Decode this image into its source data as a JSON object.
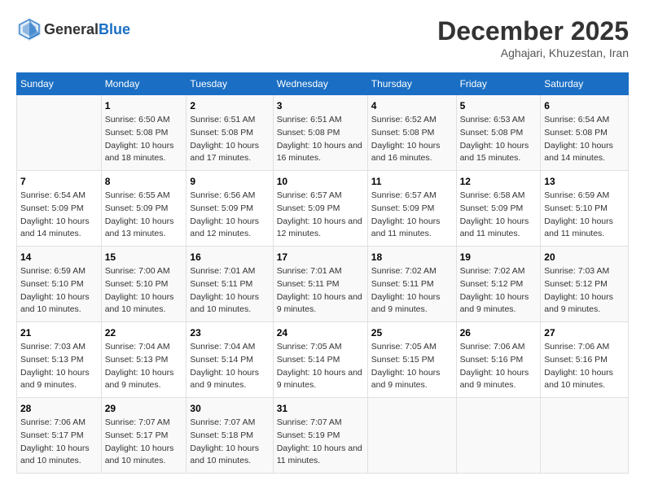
{
  "header": {
    "logo_general": "General",
    "logo_blue": "Blue",
    "month_year": "December 2025",
    "location": "Aghajari, Khuzestan, Iran"
  },
  "days_of_week": [
    "Sunday",
    "Monday",
    "Tuesday",
    "Wednesday",
    "Thursday",
    "Friday",
    "Saturday"
  ],
  "weeks": [
    [
      {
        "num": "",
        "sunrise": "",
        "sunset": "",
        "daylight": ""
      },
      {
        "num": "1",
        "sunrise": "Sunrise: 6:50 AM",
        "sunset": "Sunset: 5:08 PM",
        "daylight": "Daylight: 10 hours and 18 minutes."
      },
      {
        "num": "2",
        "sunrise": "Sunrise: 6:51 AM",
        "sunset": "Sunset: 5:08 PM",
        "daylight": "Daylight: 10 hours and 17 minutes."
      },
      {
        "num": "3",
        "sunrise": "Sunrise: 6:51 AM",
        "sunset": "Sunset: 5:08 PM",
        "daylight": "Daylight: 10 hours and 16 minutes."
      },
      {
        "num": "4",
        "sunrise": "Sunrise: 6:52 AM",
        "sunset": "Sunset: 5:08 PM",
        "daylight": "Daylight: 10 hours and 16 minutes."
      },
      {
        "num": "5",
        "sunrise": "Sunrise: 6:53 AM",
        "sunset": "Sunset: 5:08 PM",
        "daylight": "Daylight: 10 hours and 15 minutes."
      },
      {
        "num": "6",
        "sunrise": "Sunrise: 6:54 AM",
        "sunset": "Sunset: 5:08 PM",
        "daylight": "Daylight: 10 hours and 14 minutes."
      }
    ],
    [
      {
        "num": "7",
        "sunrise": "Sunrise: 6:54 AM",
        "sunset": "Sunset: 5:09 PM",
        "daylight": "Daylight: 10 hours and 14 minutes."
      },
      {
        "num": "8",
        "sunrise": "Sunrise: 6:55 AM",
        "sunset": "Sunset: 5:09 PM",
        "daylight": "Daylight: 10 hours and 13 minutes."
      },
      {
        "num": "9",
        "sunrise": "Sunrise: 6:56 AM",
        "sunset": "Sunset: 5:09 PM",
        "daylight": "Daylight: 10 hours and 12 minutes."
      },
      {
        "num": "10",
        "sunrise": "Sunrise: 6:57 AM",
        "sunset": "Sunset: 5:09 PM",
        "daylight": "Daylight: 10 hours and 12 minutes."
      },
      {
        "num": "11",
        "sunrise": "Sunrise: 6:57 AM",
        "sunset": "Sunset: 5:09 PM",
        "daylight": "Daylight: 10 hours and 11 minutes."
      },
      {
        "num": "12",
        "sunrise": "Sunrise: 6:58 AM",
        "sunset": "Sunset: 5:09 PM",
        "daylight": "Daylight: 10 hours and 11 minutes."
      },
      {
        "num": "13",
        "sunrise": "Sunrise: 6:59 AM",
        "sunset": "Sunset: 5:10 PM",
        "daylight": "Daylight: 10 hours and 11 minutes."
      }
    ],
    [
      {
        "num": "14",
        "sunrise": "Sunrise: 6:59 AM",
        "sunset": "Sunset: 5:10 PM",
        "daylight": "Daylight: 10 hours and 10 minutes."
      },
      {
        "num": "15",
        "sunrise": "Sunrise: 7:00 AM",
        "sunset": "Sunset: 5:10 PM",
        "daylight": "Daylight: 10 hours and 10 minutes."
      },
      {
        "num": "16",
        "sunrise": "Sunrise: 7:01 AM",
        "sunset": "Sunset: 5:11 PM",
        "daylight": "Daylight: 10 hours and 10 minutes."
      },
      {
        "num": "17",
        "sunrise": "Sunrise: 7:01 AM",
        "sunset": "Sunset: 5:11 PM",
        "daylight": "Daylight: 10 hours and 9 minutes."
      },
      {
        "num": "18",
        "sunrise": "Sunrise: 7:02 AM",
        "sunset": "Sunset: 5:11 PM",
        "daylight": "Daylight: 10 hours and 9 minutes."
      },
      {
        "num": "19",
        "sunrise": "Sunrise: 7:02 AM",
        "sunset": "Sunset: 5:12 PM",
        "daylight": "Daylight: 10 hours and 9 minutes."
      },
      {
        "num": "20",
        "sunrise": "Sunrise: 7:03 AM",
        "sunset": "Sunset: 5:12 PM",
        "daylight": "Daylight: 10 hours and 9 minutes."
      }
    ],
    [
      {
        "num": "21",
        "sunrise": "Sunrise: 7:03 AM",
        "sunset": "Sunset: 5:13 PM",
        "daylight": "Daylight: 10 hours and 9 minutes."
      },
      {
        "num": "22",
        "sunrise": "Sunrise: 7:04 AM",
        "sunset": "Sunset: 5:13 PM",
        "daylight": "Daylight: 10 hours and 9 minutes."
      },
      {
        "num": "23",
        "sunrise": "Sunrise: 7:04 AM",
        "sunset": "Sunset: 5:14 PM",
        "daylight": "Daylight: 10 hours and 9 minutes."
      },
      {
        "num": "24",
        "sunrise": "Sunrise: 7:05 AM",
        "sunset": "Sunset: 5:14 PM",
        "daylight": "Daylight: 10 hours and 9 minutes."
      },
      {
        "num": "25",
        "sunrise": "Sunrise: 7:05 AM",
        "sunset": "Sunset: 5:15 PM",
        "daylight": "Daylight: 10 hours and 9 minutes."
      },
      {
        "num": "26",
        "sunrise": "Sunrise: 7:06 AM",
        "sunset": "Sunset: 5:16 PM",
        "daylight": "Daylight: 10 hours and 9 minutes."
      },
      {
        "num": "27",
        "sunrise": "Sunrise: 7:06 AM",
        "sunset": "Sunset: 5:16 PM",
        "daylight": "Daylight: 10 hours and 10 minutes."
      }
    ],
    [
      {
        "num": "28",
        "sunrise": "Sunrise: 7:06 AM",
        "sunset": "Sunset: 5:17 PM",
        "daylight": "Daylight: 10 hours and 10 minutes."
      },
      {
        "num": "29",
        "sunrise": "Sunrise: 7:07 AM",
        "sunset": "Sunset: 5:17 PM",
        "daylight": "Daylight: 10 hours and 10 minutes."
      },
      {
        "num": "30",
        "sunrise": "Sunrise: 7:07 AM",
        "sunset": "Sunset: 5:18 PM",
        "daylight": "Daylight: 10 hours and 10 minutes."
      },
      {
        "num": "31",
        "sunrise": "Sunrise: 7:07 AM",
        "sunset": "Sunset: 5:19 PM",
        "daylight": "Daylight: 10 hours and 11 minutes."
      },
      {
        "num": "",
        "sunrise": "",
        "sunset": "",
        "daylight": ""
      },
      {
        "num": "",
        "sunrise": "",
        "sunset": "",
        "daylight": ""
      },
      {
        "num": "",
        "sunrise": "",
        "sunset": "",
        "daylight": ""
      }
    ]
  ]
}
